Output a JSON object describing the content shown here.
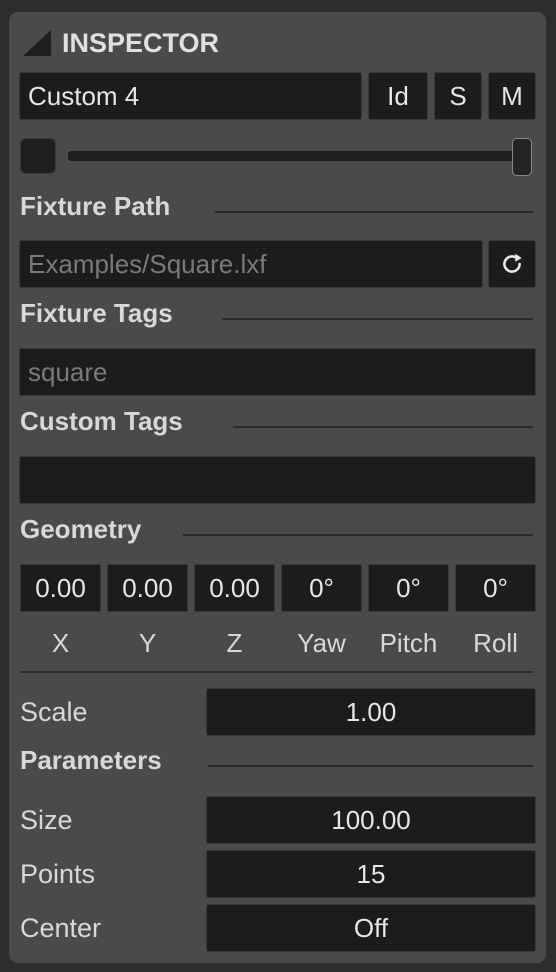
{
  "header": {
    "title": "INSPECTOR"
  },
  "name_row": {
    "name": "Custom 4",
    "id_label": "Id",
    "s_label": "S",
    "m_label": "M"
  },
  "brightness": {
    "value": 1.0
  },
  "fixture_path": {
    "label": "Fixture Path",
    "value": "Examples/Square.lxf",
    "reload_icon": "reload-icon"
  },
  "fixture_tags": {
    "label": "Fixture Tags",
    "value": "square"
  },
  "custom_tags": {
    "label": "Custom Tags",
    "value": ""
  },
  "geometry": {
    "label": "Geometry",
    "fields": [
      {
        "value": "0.00",
        "axis": "X"
      },
      {
        "value": "0.00",
        "axis": "Y"
      },
      {
        "value": "0.00",
        "axis": "Z"
      },
      {
        "value": "0°",
        "axis": "Yaw"
      },
      {
        "value": "0°",
        "axis": "Pitch"
      },
      {
        "value": "0°",
        "axis": "Roll"
      }
    ]
  },
  "scale": {
    "label": "Scale",
    "value": "1.00"
  },
  "parameters": {
    "label": "Parameters",
    "rows": [
      {
        "label": "Size",
        "value": "100.00"
      },
      {
        "label": "Points",
        "value": "15"
      },
      {
        "label": "Center",
        "value": "Off"
      }
    ]
  },
  "colors": {
    "panel": "#4a4a4a",
    "field": "#1c1c1c",
    "text": "#d6d6d6"
  }
}
